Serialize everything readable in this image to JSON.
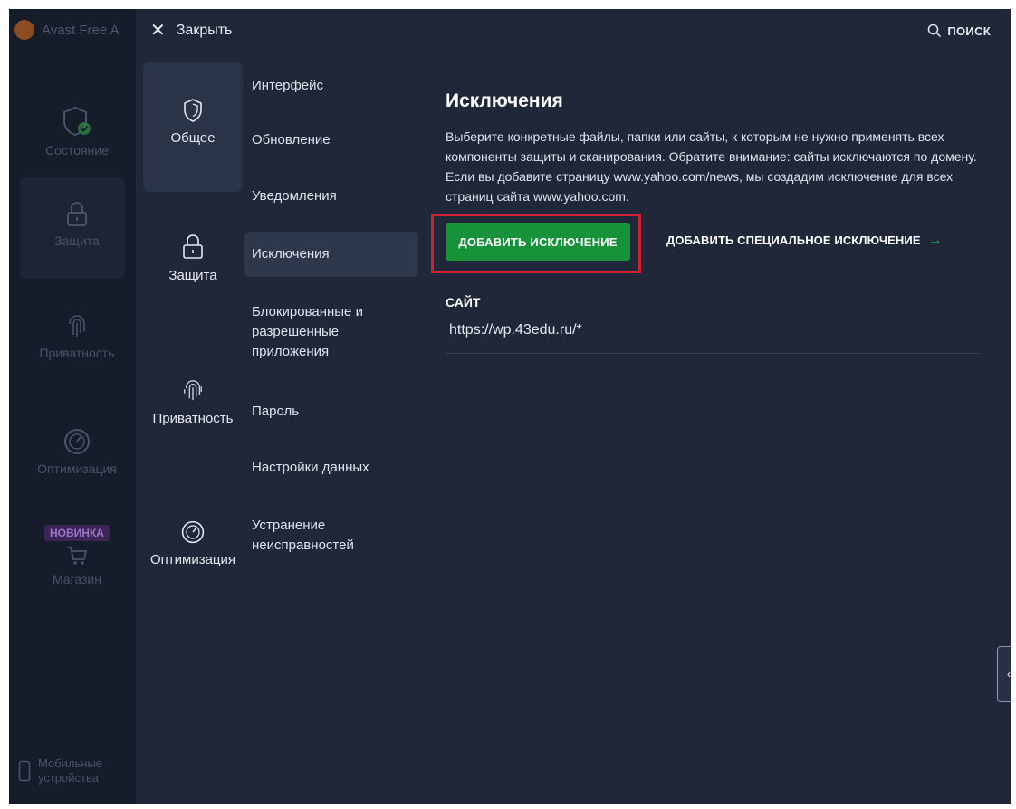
{
  "background_app": {
    "title": "Avast Free A",
    "nav": [
      {
        "label": "Состояние",
        "icon": "shield-check-icon"
      },
      {
        "label": "Защита",
        "icon": "lock-icon"
      },
      {
        "label": "Приватность",
        "icon": "fingerprint-icon"
      },
      {
        "label": "Оптимизация",
        "icon": "speedometer-icon"
      },
      {
        "label": "Магазин",
        "icon": "cart-icon",
        "badge": "НОВИНКА"
      }
    ],
    "mobile_line1": "Мобильные",
    "mobile_line2": "устройства"
  },
  "header": {
    "close_label": "Закрыть",
    "search_label": "ПОИСК"
  },
  "categories": [
    {
      "label": "Общее",
      "icon": "shield-icon",
      "active": true
    },
    {
      "label": "Защита",
      "icon": "lock-icon",
      "active": false
    },
    {
      "label": "Приватность",
      "icon": "fingerprint-icon",
      "active": false
    },
    {
      "label": "Оптимизация",
      "icon": "speedometer-icon",
      "active": false
    }
  ],
  "subnav": [
    {
      "label": "Интерфейс"
    },
    {
      "label": "Обновление"
    },
    {
      "label": "Уведомления"
    },
    {
      "label": "Исключения",
      "active": true
    },
    {
      "label_lines": [
        "Блокированные и",
        "разрешенные",
        "приложения"
      ]
    },
    {
      "label": "Пароль"
    },
    {
      "label": "Настройки данных"
    },
    {
      "label_lines": [
        "Устранение",
        "неисправностей"
      ]
    }
  ],
  "content": {
    "title": "Исключения",
    "description": "Выберите конкретные файлы, папки или сайты, к которым не нужно применять всех компоненты защиты и сканирования. Обратите внимание: сайты исключаются по домену. Если вы добавите страницу www.yahoo.com/news, мы создадим исключение для всех страниц сайта www.yahoo.com.",
    "add_button": "ДОБАВИТЬ ИСКЛЮЧЕНИЕ",
    "add_special": "ДОБАВИТЬ СПЕЦИАЛЬНОЕ ИСКЛЮЧЕНИЕ",
    "column_header": "САЙТ",
    "entries": [
      "https://wp.43edu.ru/*"
    ]
  },
  "colors": {
    "panel_bg": "#202738",
    "accent_green": "#18923a",
    "highlight_red": "#d01f2f"
  }
}
